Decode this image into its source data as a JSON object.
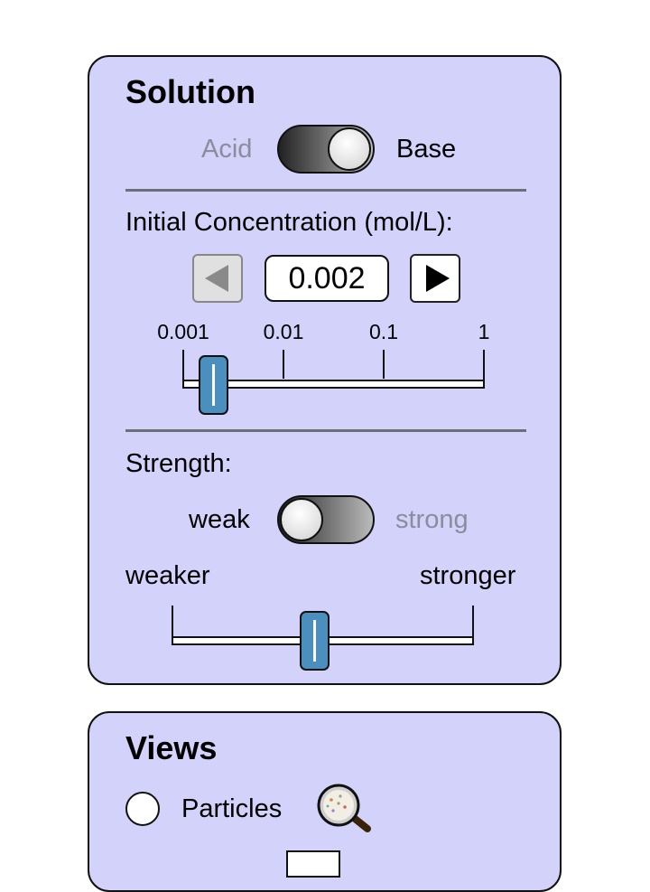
{
  "solution": {
    "title": "Solution",
    "type_toggle": {
      "left_label": "Acid",
      "right_label": "Base",
      "selected": "Base"
    },
    "concentration": {
      "label": "Initial Concentration (mol/L):",
      "value": "0.002",
      "decrement_icon": "left-arrow-icon",
      "increment_icon": "right-arrow-icon",
      "slider_ticks": [
        "0.001",
        "0.01",
        "0.1",
        "1"
      ],
      "slider_scale": "log",
      "slider_value": 0.002
    },
    "strength": {
      "label": "Strength:",
      "toggle": {
        "left_label": "weak",
        "right_label": "strong",
        "selected": "weak"
      },
      "slider_min_label": "weaker",
      "slider_max_label": "stronger",
      "slider_fraction": 0.47
    }
  },
  "views": {
    "title": "Views",
    "options": [
      {
        "label": "Particles",
        "icon": "magnifier-icon",
        "selected": false
      }
    ]
  },
  "colors": {
    "panel_background": "#d2d2fb",
    "slider_thumb": "#4a8fbd",
    "inactive_label": "#8c8c9c"
  }
}
